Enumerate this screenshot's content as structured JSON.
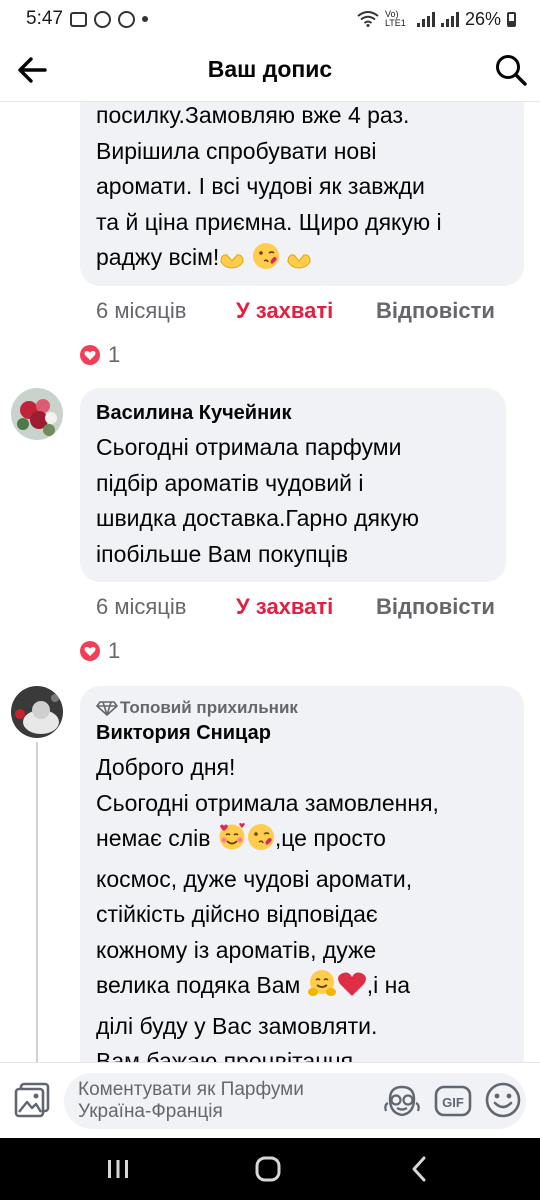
{
  "status_bar": {
    "time": "5:47",
    "network": "Vo) LTE1",
    "battery": "26%"
  },
  "header": {
    "title": "Ваш допис"
  },
  "comments": [
    {
      "text": "посилку.Замовляю вже 4 раз.\nВирішила спробувати нові\nаромати. І всі чудові як завжди\nта й ціна приємна. Щиро дякую і\nраджу всім!",
      "time": "6 місяців",
      "reaction_label": "У захваті",
      "reply_label": "Відповісти",
      "reaction_count": "1"
    },
    {
      "author": "Василина Кучейник",
      "text": "Сьогодні отримала парфуми\nпідбір ароматів чудовий і\nшвидка доставка.Гарно дякую\nіпобільше Вам покупців",
      "time": "6 місяців",
      "reaction_label": "У захваті",
      "reply_label": "Відповісти",
      "reaction_count": "1"
    },
    {
      "badge": "Топовий прихильник",
      "author": "Виктория Сницар",
      "line1": "Доброго дня!",
      "line2": "Сьогодні отримала замовлення,",
      "line3a": "немає слів ",
      "line3b": ",це просто",
      "line4": "космос, дуже чудові аромати,",
      "line5": "стійкість дійсно відповідає",
      "line6": "кожному із ароматів, дуже",
      "line7a": "велика подяка Вам ",
      "line7b": ",і на",
      "line8": "ділі буду у Вас замовляти.",
      "line9": "Вам бажаю процвітання"
    }
  ],
  "composer": {
    "placeholder": "Коментувати як Парфуми Україна-Франція"
  },
  "colors": {
    "accent_reaction": "#e41e3f",
    "bubble_bg": "#f0f2f5",
    "secondary_text": "#65676b"
  },
  "icons": [
    "back-arrow-icon",
    "search-icon",
    "heart-icon",
    "diamond-icon",
    "photo-icon",
    "avatar-reaction-icon",
    "gif-icon",
    "smile-icon",
    "recent-apps-icon",
    "home-icon",
    "back-nav-icon"
  ]
}
